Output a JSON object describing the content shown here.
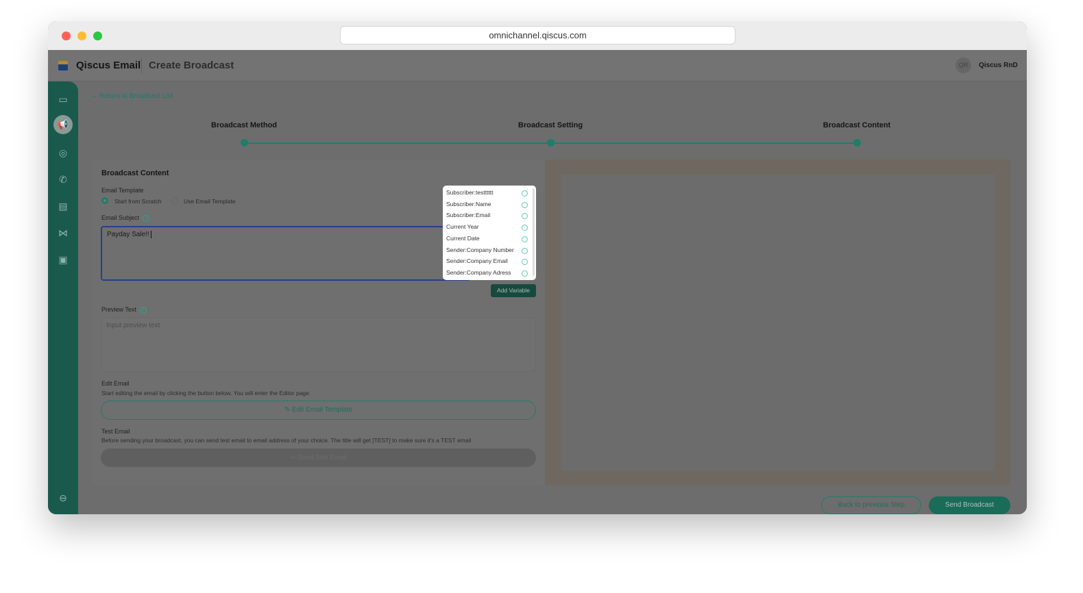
{
  "browser": {
    "url": "omnichannel.qiscus.com"
  },
  "header": {
    "app_name": "Qiscus Email",
    "page_title": "Create Broadcast",
    "avatar_initials": "QR",
    "user_name": "Qiscus RnD"
  },
  "nav": {
    "back_link": "Return to Broadcast List"
  },
  "steps": [
    {
      "label": "Broadcast Method"
    },
    {
      "label": "Broadcast Setting"
    },
    {
      "label": "Broadcast Content"
    }
  ],
  "form": {
    "section_title": "Broadcast Content",
    "template_label": "Email Template",
    "template_options": [
      "Start from Scratch",
      "Use Email Template"
    ],
    "subject_label": "Email Subject",
    "subject_value": "Payday Sale!!",
    "add_variable": "Add Variable",
    "variables": [
      "Subscriber:testttttt",
      "Subscriber:Name",
      "Subscriber:Email",
      "Current Year",
      "Current Date",
      "Sender:Company Number",
      "Sender:Company Email",
      "Sender:Company Adress"
    ],
    "preview_label": "Preview Text",
    "preview_placeholder": "Input preview text",
    "edit_label": "Edit Email",
    "edit_desc": "Start editing the email by clicking the button below. You will enter the Editor page.",
    "edit_button": "Edit Email Template",
    "test_label": "Test Email",
    "test_desc": "Before sending your broadcast, you can send test email to email address of your choice. The title will get [TEST] to make sure it's a TEST email",
    "test_button": "Send Test Email"
  },
  "footer": {
    "back": "Back to previous Step",
    "send": "Send Broadcast"
  },
  "colors": {
    "primary": "#1a5a4c",
    "accent": "#2aa58a"
  }
}
